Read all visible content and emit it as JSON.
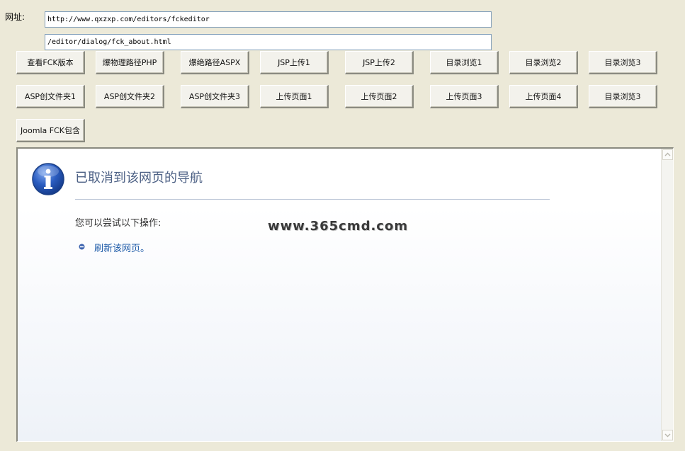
{
  "url_bar": {
    "label": "网址:",
    "base_url": "http://www.qxzxp.com/editors/fckeditor",
    "path": "/editor/dialog/fck_about.html"
  },
  "buttons": {
    "row1": [
      "查看FCK版本",
      "爆物理路径PHP",
      "爆绝路径ASPX",
      "JSP上传1",
      "JSP上传2",
      "目录浏览1",
      "目录浏览2",
      "目录浏览3"
    ],
    "row2": [
      "ASP创文件夹1",
      "ASP创文件夹2",
      "ASP创文件夹3",
      "上传页面1",
      "上传页面2",
      "上传页面3",
      "上传页面4",
      "目录浏览3"
    ],
    "row3": [
      "Joomla FCK包含"
    ]
  },
  "browser": {
    "title": "已取消到该网页的导航",
    "try_text": "您可以尝试以下操作:",
    "refresh_link": "刷新该网页。",
    "watermark": "www.365cmd.com"
  },
  "colors": {
    "background": "#ece9d8",
    "title": "#4d6185",
    "link": "#1d5aa8",
    "info_icon": "#2456b3"
  }
}
